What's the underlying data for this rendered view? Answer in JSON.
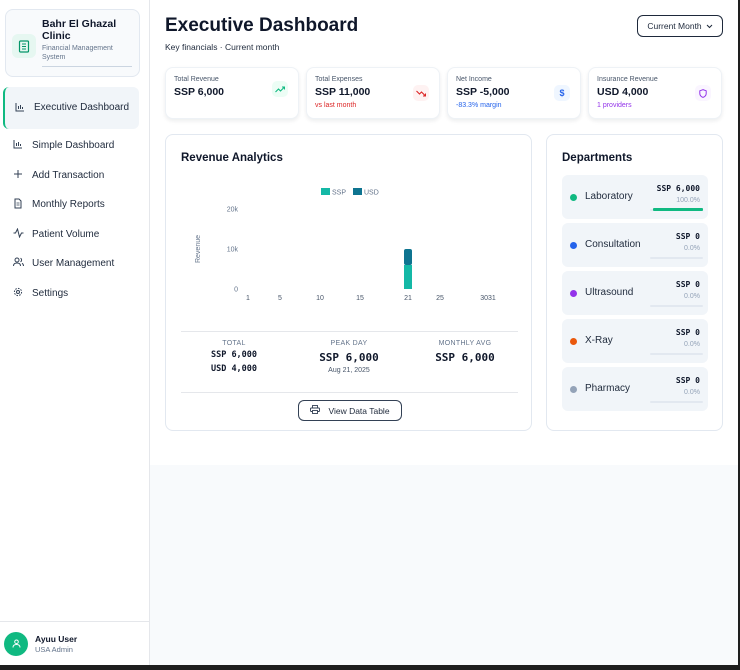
{
  "brand": {
    "name": "Bahr El Ghazal Clinic",
    "subtitle": "Financial Management System",
    "icon": "hospital-icon"
  },
  "sidebar": {
    "items": [
      {
        "label": "Executive Dashboard",
        "icon": "bar-chart-icon",
        "active": true
      },
      {
        "label": "Simple Dashboard",
        "icon": "bar-chart-icon"
      },
      {
        "label": "Add Transaction",
        "icon": "plus-icon"
      },
      {
        "label": "Monthly Reports",
        "icon": "document-icon"
      },
      {
        "label": "Patient Volume",
        "icon": "activity-icon"
      },
      {
        "label": "User Management",
        "icon": "users-icon"
      },
      {
        "label": "Settings",
        "icon": "gear-icon"
      }
    ]
  },
  "user": {
    "name": "Ayuu User",
    "role": "USA Admin",
    "avatar_color": "#10b981"
  },
  "header": {
    "title": "Executive Dashboard",
    "subtitle": "Key financials · Current month",
    "period": "Current Month"
  },
  "kpis": [
    {
      "label": "Total Revenue",
      "value": "SSP 6,000",
      "note": "",
      "icon": "trending-up-icon",
      "color": "#10b981"
    },
    {
      "label": "Total Expenses",
      "value": "SSP 11,000",
      "note": "vs last month",
      "icon": "trending-down-icon",
      "color": "#dc2626"
    },
    {
      "label": "Net Income",
      "value": "SSP -5,000",
      "note": "-83.3% margin",
      "icon": "dollar-icon",
      "color": "#2563eb"
    },
    {
      "label": "Insurance Revenue",
      "value": "USD 4,000",
      "note": "1 providers",
      "icon": "shield-icon",
      "color": "#9333ea"
    }
  ],
  "revenue": {
    "title": "Revenue Analytics",
    "stats": {
      "total_label": "TOTAL",
      "total_ssp": "SSP 6,000",
      "total_usd": "USD 4,000",
      "peak_label": "PEAK DAY",
      "peak_value": "SSP 6,000",
      "peak_date": "Aug 21, 2025",
      "avg_label": "MONTHLY AVG",
      "avg_value": "SSP 6,000"
    },
    "table_button": "View Data Table"
  },
  "chart_data": {
    "type": "bar",
    "ylabel": "Revenue",
    "ylim": [
      0,
      20000
    ],
    "yticks": [
      "20k",
      "10k",
      "0"
    ],
    "xticks": [
      "1",
      "5",
      "10",
      "15",
      "21",
      "25",
      "3031"
    ],
    "x_tick_values": [
      1,
      5,
      10,
      15,
      21,
      25,
      31
    ],
    "xlim": [
      1,
      31
    ],
    "stacked": true,
    "legend_position": "top",
    "series": [
      {
        "name": "SSP",
        "color": "#14b8a6",
        "points": [
          {
            "x": 21,
            "y": 6000
          }
        ]
      },
      {
        "name": "USD",
        "color": "#0e7490",
        "points": [
          {
            "x": 21,
            "y": 4000
          }
        ]
      }
    ]
  },
  "departments": {
    "title": "Departments",
    "items": [
      {
        "name": "Laboratory",
        "amount": "SSP 6,000",
        "percent": "100.0%",
        "share": 1.0,
        "color": "#10b981"
      },
      {
        "name": "Consultation",
        "amount": "SSP 0",
        "percent": "0.0%",
        "share": 0.0,
        "color": "#2563eb"
      },
      {
        "name": "Ultrasound",
        "amount": "SSP 0",
        "percent": "0.0%",
        "share": 0.0,
        "color": "#9333ea"
      },
      {
        "name": "X-Ray",
        "amount": "SSP 0",
        "percent": "0.0%",
        "share": 0.0,
        "color": "#ea580c"
      },
      {
        "name": "Pharmacy",
        "amount": "SSP 0",
        "percent": "0.0%",
        "share": 0.0,
        "color": "#94a3b8"
      }
    ]
  }
}
